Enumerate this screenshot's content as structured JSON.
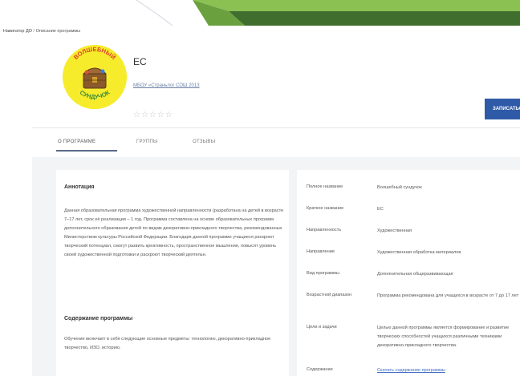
{
  "colors": {
    "accent": "#2f5aa8",
    "decor_green_dark": "#3f6e2f",
    "decor_green_light": "#8bc152",
    "logo_bg": "#f7ec2b"
  },
  "breadcrumb": {
    "home": "Навигатор ДО",
    "separator": " / ",
    "current": "Описание программы"
  },
  "program": {
    "logo_text_top": "ВОЛШЕБНЫЙ",
    "logo_text_bottom": "СУНДУЧОК",
    "title": "ЕС",
    "organization": "МБОУ «Страньлог СОШ 2013",
    "rating": "☆☆☆☆☆",
    "enroll_button": "ЗАПИСАТЬСЯ"
  },
  "tabs": [
    {
      "label": "О ПРОГРАММЕ",
      "active": true
    },
    {
      "label": "ГРУППЫ",
      "active": false
    },
    {
      "label": "ОТЗЫВЫ",
      "active": false
    }
  ],
  "annotation": {
    "heading": "Аннотация",
    "text": "Данная образовательная программа художественной направленности (разработана на детей в возрасте 7–17 лет, срок её реализации – 1 год. Программа составлена на основе образовательных программ дополнительного образования детей по видам декоративно-прикладного творчества, рекомендованных Министерством культуры Российской Федерации. Благодаря данной программе учащиеся раскроют творческий потенциал, смогут развить креативность, пространственное мышление, повысят уровень своей художественной подготовки и раскроют творческий деятельн."
  },
  "content": {
    "heading": "Содержание программы",
    "text": "Обучение включает в себя следующие основные предметы: технологию, декоративно-прикладное творчество, ИЗО, историю."
  },
  "properties": [
    {
      "label": "Полное название",
      "value": "Волшебный сундучок"
    },
    {
      "label": "Краткое название",
      "value": "ЕС"
    },
    {
      "label": "Направленность",
      "value": "Художественная"
    },
    {
      "label": "Направление",
      "value": "Художественная обработка материалов"
    },
    {
      "label": "Вид программы",
      "value": "Дополнительная общеразвивающая"
    },
    {
      "label": "Возрастной диапазон",
      "value": "Программа рекомендована для учащихся в возрасте от 7 до 17 лет"
    },
    {
      "label": "Цели и задачи",
      "value": "Целью данной программы является формирование и развитие творческих способностей учащихся различными техниками декоративно-прикладного творчества."
    },
    {
      "label": "Содержание",
      "value": "Скачать содержание программы",
      "link": true
    }
  ]
}
